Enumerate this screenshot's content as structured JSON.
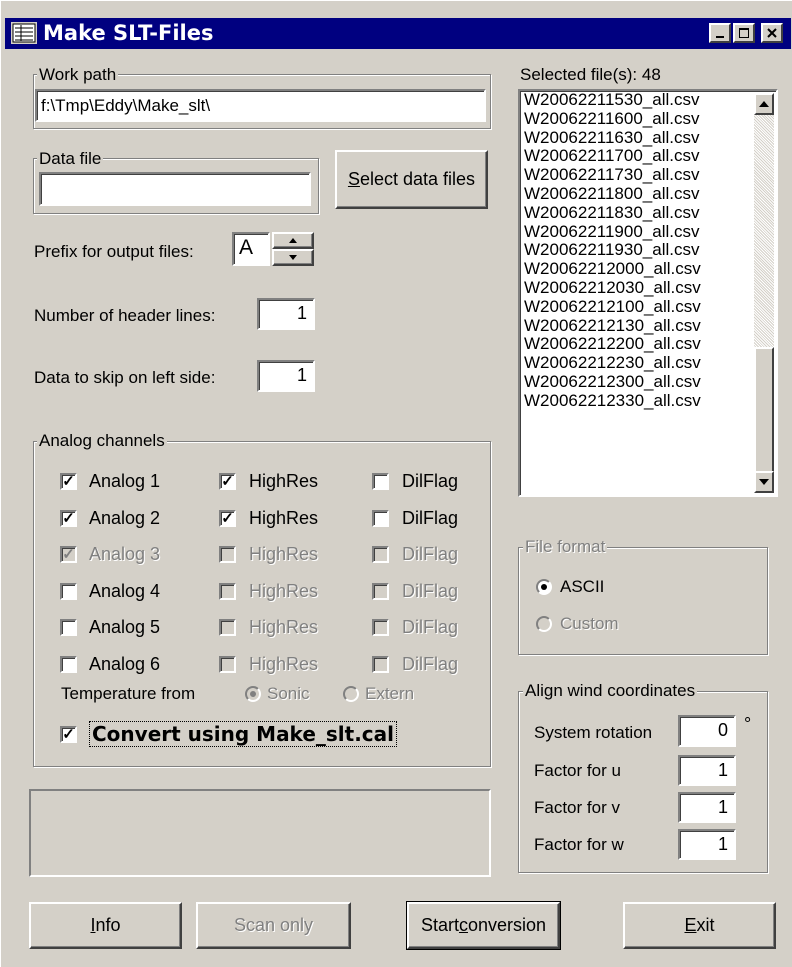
{
  "window": {
    "title": "Make SLT-Files"
  },
  "work_path": {
    "label": "Work path",
    "value": "f:\\Tmp\\Eddy\\Make_slt\\"
  },
  "data_file": {
    "label": "Data file",
    "value": ""
  },
  "select_button": {
    "pre": "",
    "u": "S",
    "post": "elect data files"
  },
  "prefix": {
    "label": "Prefix for output files:",
    "value": "A"
  },
  "header_lines": {
    "label": "Number of header lines:",
    "value": "1"
  },
  "skip_left": {
    "label": "Data to skip on left side:",
    "value": "1"
  },
  "analog": {
    "label": "Analog channels",
    "rows": [
      {
        "name": "Analog 1",
        "checked": true,
        "disabled": false,
        "highres": "HighRes",
        "hr_checked": true,
        "hr_dis": false,
        "dilflag": "DilFlag",
        "dil_dis": false
      },
      {
        "name": "Analog 2",
        "checked": true,
        "disabled": false,
        "highres": "HighRes",
        "hr_checked": true,
        "hr_dis": false,
        "dilflag": "DilFlag",
        "dil_dis": false
      },
      {
        "name": "Analog 3",
        "checked": true,
        "disabled": true,
        "highres": "HighRes",
        "hr_checked": false,
        "hr_dis": true,
        "dilflag": "DilFlag",
        "dil_dis": true
      },
      {
        "name": "Analog 4",
        "checked": false,
        "disabled": false,
        "highres": "HighRes",
        "hr_checked": false,
        "hr_dis": true,
        "dilflag": "DilFlag",
        "dil_dis": true
      },
      {
        "name": "Analog 5",
        "checked": false,
        "disabled": false,
        "highres": "HighRes",
        "hr_checked": false,
        "hr_dis": true,
        "dilflag": "DilFlag",
        "dil_dis": true
      },
      {
        "name": "Analog 6",
        "checked": false,
        "disabled": false,
        "highres": "HighRes",
        "hr_checked": false,
        "hr_dis": true,
        "dilflag": "DilFlag",
        "dil_dis": true
      }
    ],
    "temperature_label": "Temperature from",
    "sonic": "Sonic",
    "extern": "Extern",
    "convert_label": "Convert using Make_slt.cal"
  },
  "selected": {
    "label": "Selected file(s): 48",
    "files": [
      "W20062211530_all.csv",
      "W20062211600_all.csv",
      "W20062211630_all.csv",
      "W20062211700_all.csv",
      "W20062211730_all.csv",
      "W20062211800_all.csv",
      "W20062211830_all.csv",
      "W20062211900_all.csv",
      "W20062211930_all.csv",
      "W20062212000_all.csv",
      "W20062212030_all.csv",
      "W20062212100_all.csv",
      "W20062212130_all.csv",
      "W20062212200_all.csv",
      "W20062212230_all.csv",
      "W20062212300_all.csv",
      "W20062212330_all.csv"
    ]
  },
  "file_format": {
    "label": "File format",
    "ascii": "ASCII",
    "custom": "Custom"
  },
  "align": {
    "label": "Align wind coordinates",
    "system_rotation": "System rotation",
    "rotation_value": "0",
    "degree": "°",
    "factor_u": "Factor for u",
    "u_value": "1",
    "factor_v": "Factor for v",
    "v_value": "1",
    "factor_w": "Factor for w",
    "w_value": "1"
  },
  "buttons": {
    "info_u": "I",
    "info_post": "nfo",
    "scan": "Scan only",
    "start_pre": "Start ",
    "start_u": "c",
    "start_post": "onversion",
    "exit_u": "E",
    "exit_post": "xit"
  }
}
